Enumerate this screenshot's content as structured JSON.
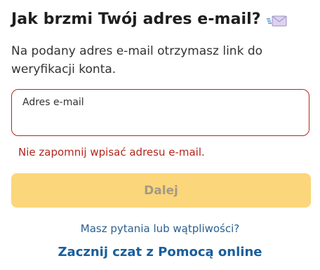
{
  "header": {
    "title": "Jak brzmi Twój adres e-mail?",
    "icon": "envelope-icon"
  },
  "subtitle": "Na podany adres e-mail otrzymasz link do weryfikacji konta.",
  "email_field": {
    "label": "Adres e-mail",
    "value": "",
    "placeholder": "",
    "error": "Nie zapomnij wpisać adresu e-mail."
  },
  "submit_button": {
    "label": "Dalej",
    "disabled": true
  },
  "help": {
    "question": "Masz pytania lub wątpliwości?",
    "chat_link": "Zacznij czat z Pomocą online"
  },
  "colors": {
    "error": "#b3261e",
    "button_bg": "#fcd67a",
    "button_text": "#a39a86",
    "link": "#1a5f9c"
  }
}
